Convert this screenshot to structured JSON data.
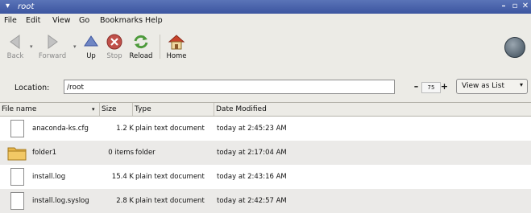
{
  "window": {
    "title": "root",
    "controls": {
      "minimize": "–",
      "maximize": "▫",
      "close": "✕"
    }
  },
  "menubar": {
    "items": [
      {
        "label": "File"
      },
      {
        "label": "Edit"
      },
      {
        "label": "View"
      },
      {
        "label": "Go"
      },
      {
        "label": "Bookmarks"
      },
      {
        "label": "Help"
      }
    ]
  },
  "toolbar": {
    "back": "Back",
    "forward": "Forward",
    "up": "Up",
    "stop": "Stop",
    "reload": "Reload",
    "home": "Home"
  },
  "location": {
    "label": "Location:",
    "value": "/root"
  },
  "zoom": {
    "value": "75",
    "minus": "–",
    "plus": "+"
  },
  "view_selector": {
    "selected": "View as List"
  },
  "columns": {
    "name": "File name",
    "size": "Size",
    "type": "Type",
    "date": "Date Modified"
  },
  "files": [
    {
      "name": "anaconda-ks.cfg",
      "size": "1.2 K",
      "type": "plain text document",
      "date": "today at 2:45:23 AM",
      "kind": "file"
    },
    {
      "name": "folder1",
      "size": "0 items",
      "type": "folder",
      "date": "today at 2:17:04 AM",
      "kind": "folder"
    },
    {
      "name": "install.log",
      "size": "15.4 K",
      "type": "plain text document",
      "date": "today at 2:43:16 AM",
      "kind": "file"
    },
    {
      "name": "install.log.syslog",
      "size": "2.8 K",
      "type": "plain text document",
      "date": "today at 2:42:57 AM",
      "kind": "file"
    }
  ],
  "colors": {
    "titlebar": "#3c55a0",
    "chrome": "#ecebe6",
    "alt_row": "#ebeae8",
    "folder": "#e8b64a"
  }
}
